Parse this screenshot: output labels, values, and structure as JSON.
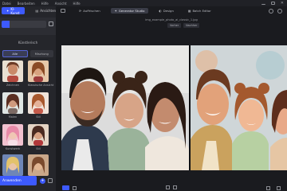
{
  "menu": {
    "items": [
      "Datei",
      "Bearbeiten",
      "Hilfe",
      "Ansicht",
      "Hilfe"
    ]
  },
  "left_panel": {
    "tabs": [
      {
        "label": "KI-Kunst",
        "icon": "sparkle-icon"
      },
      {
        "label": "Ansichten",
        "icon": "layers-icon"
      }
    ],
    "section_label": "Künstlerisch",
    "segments": [
      "Alle",
      "Mischung"
    ],
    "styles": [
      {
        "label": "Zeichnen"
      },
      {
        "label": "Klassische Ansicht"
      },
      {
        "label": "Malen"
      },
      {
        "label": "Stil"
      },
      {
        "label": "Kunstwerk"
      },
      {
        "label": "Stil"
      },
      {
        "label": ""
      },
      {
        "label": ""
      }
    ],
    "apply_label": "Anwenden"
  },
  "toolbar": {
    "tabs": [
      {
        "label": "Auffrischen",
        "active": false
      },
      {
        "label": "Generator Studio",
        "active": true
      },
      {
        "label": "Design",
        "active": false
      },
      {
        "label": "Batch Editor",
        "active": false
      }
    ]
  },
  "main": {
    "file_title": "img_example_photo_ai_classic_1.jpg",
    "compare": [
      "Vorher",
      "Nachher"
    ]
  },
  "colors": {
    "accent": "#3d5afe",
    "panel": "#25262b",
    "canvas": "#1a1b1f"
  }
}
